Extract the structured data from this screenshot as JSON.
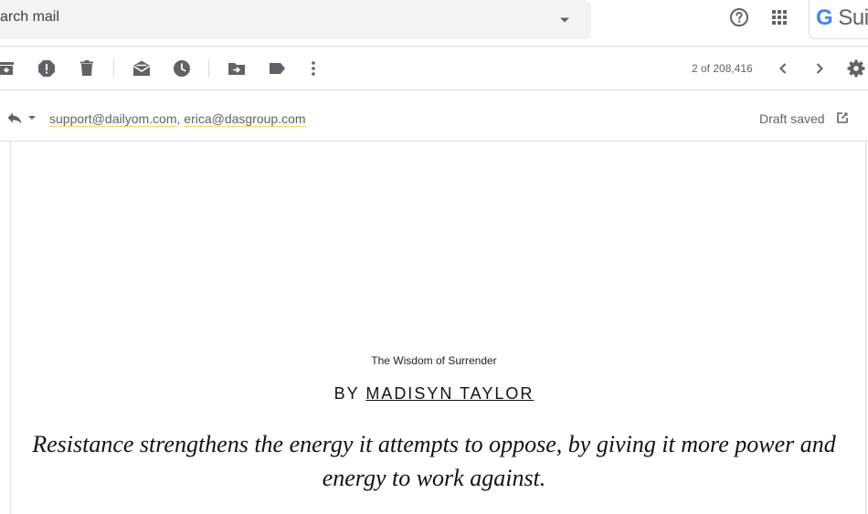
{
  "search": {
    "text": "arch mail"
  },
  "header": {
    "brand_g": "G",
    "brand_rest": " Sui",
    "icons": [
      "help-icon",
      "apps-icon"
    ]
  },
  "toolbar": {
    "icons": [
      "archive-icon",
      "report-spam-icon",
      "delete-icon",
      "mark-unread-icon",
      "snooze-icon",
      "move-to-icon",
      "label-icon",
      "more-vert-icon"
    ],
    "pager": "2 of 208,416",
    "nav_icons": [
      "chevron-left-icon",
      "chevron-right-icon",
      "gear-icon"
    ]
  },
  "compose": {
    "recipient_1": "support@dailyom.com",
    "separator": ", ",
    "recipient_2": "erica@dasgroup.com",
    "draft_status": "Draft saved"
  },
  "email": {
    "caption": "The Wisdom of Surrender",
    "by_prefix": "BY ",
    "author": "MADISYN TAYLOR",
    "quote": "Resistance strengthens the energy it attempts to oppose, by giving it more power and energy to work against."
  },
  "colors": {
    "icon": "#5f6368",
    "search_bg": "#f1f3f4",
    "border": "#e0e0e0",
    "recipient_underline": "#fdd663",
    "brand_blue": "#4285f4"
  }
}
